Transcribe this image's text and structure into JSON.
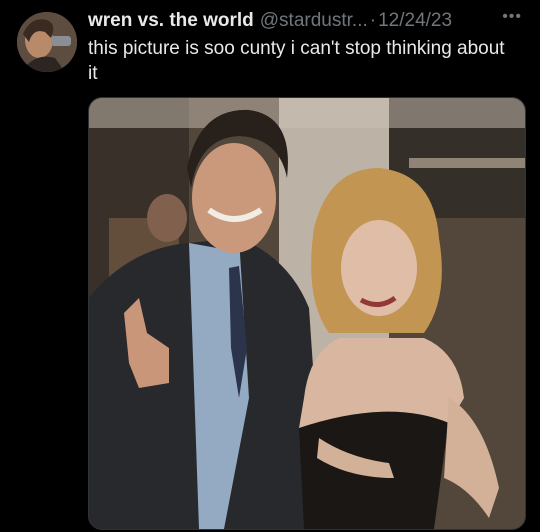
{
  "tweet": {
    "author_name": "wren vs. the world",
    "handle": "@stardustr...",
    "separator": "·",
    "date": "12/24/23",
    "more_icon": "more-horizontal-icon",
    "text": "this picture is soo cunty i can't stop thinking about it"
  },
  "media": {
    "kind": "photo"
  }
}
